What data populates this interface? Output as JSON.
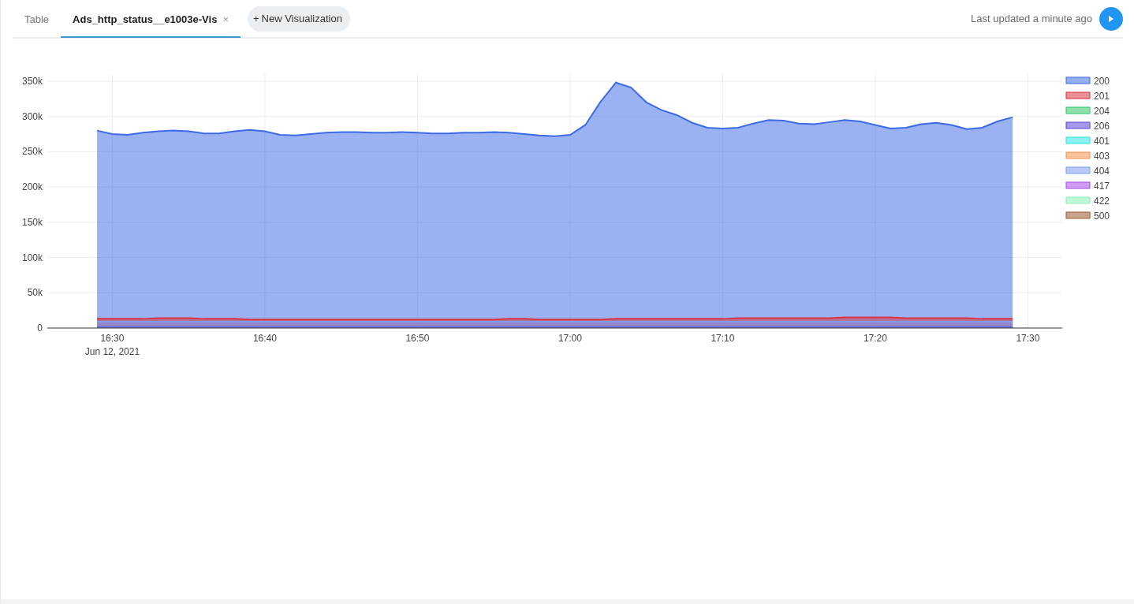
{
  "tabs": [
    {
      "label": "Table",
      "selected": false
    },
    {
      "label": "Ads_http_status__e1003e-Vis",
      "selected": true,
      "close": "×"
    }
  ],
  "new_button": {
    "icon": "+",
    "label": "New Visualization"
  },
  "status": {
    "text": "Last updated a minute ago"
  },
  "chart": {
    "chart_data": {
      "type": "area",
      "stacked": false,
      "categories": [
        null,
        "16:30",
        null,
        null,
        null,
        null,
        null,
        null,
        null,
        null,
        null,
        "16:40",
        null,
        null,
        null,
        null,
        null,
        null,
        null,
        null,
        null,
        "16:50",
        null,
        null,
        null,
        null,
        null,
        null,
        null,
        null,
        null,
        "17:00",
        null,
        null,
        null,
        null,
        null,
        null,
        null,
        null,
        null,
        "17:10",
        null,
        null,
        null,
        null,
        null,
        null,
        null,
        null,
        null,
        "17:20",
        null,
        null,
        null,
        null,
        null,
        null,
        null,
        null,
        null,
        "17:30"
      ],
      "ylim": [
        0,
        350000
      ],
      "grid": true,
      "legend": true,
      "yticks": [
        {
          "value": 0,
          "label": "0"
        },
        {
          "value": 50000,
          "label": "50k"
        },
        {
          "value": 100000,
          "label": "100k"
        },
        {
          "value": 150000,
          "label": "150k"
        },
        {
          "value": 200000,
          "label": "200k"
        },
        {
          "value": 250000,
          "label": "250k"
        },
        {
          "value": 300000,
          "label": "300k"
        },
        {
          "value": 350000,
          "label": "350k"
        }
      ],
      "series": [
        {
          "name": "200",
          "color": "#3d6be6",
          "values": [
            280000,
            275000,
            274000,
            277000,
            279000,
            280000,
            279000,
            276000,
            276000,
            279000,
            281000,
            279000,
            274000,
            273000,
            275000,
            277000,
            278000,
            278000,
            277000,
            277000,
            278000,
            277000,
            276000,
            276000,
            277000,
            277000,
            278000,
            277000,
            275000,
            273000,
            272000,
            274000,
            288000,
            321000,
            348000,
            341000,
            320000,
            309000,
            302000,
            291000,
            284000,
            283000,
            284000,
            290000,
            295000,
            294000,
            290000,
            289000,
            292000,
            295000,
            293000,
            288000,
            283000,
            284000,
            289000,
            291000,
            288000,
            282000,
            284000,
            293000,
            299000,
            null
          ]
        },
        {
          "name": "201",
          "color": "#d9333f",
          "values": [
            13000,
            13000,
            13000,
            13000,
            14000,
            14000,
            14000,
            13000,
            13000,
            13000,
            12000,
            12000,
            12000,
            12000,
            12000,
            12000,
            12000,
            12000,
            12000,
            12000,
            12000,
            12000,
            12000,
            12000,
            12000,
            12000,
            12000,
            13000,
            13000,
            12000,
            12000,
            12000,
            12000,
            12000,
            13000,
            13000,
            13000,
            13000,
            13000,
            13000,
            13000,
            13000,
            14000,
            14000,
            14000,
            14000,
            14000,
            14000,
            14000,
            15000,
            15000,
            15000,
            15000,
            14000,
            14000,
            14000,
            14000,
            14000,
            13000,
            13000,
            13000,
            null
          ]
        },
        {
          "name": "204",
          "color": "#2fc768",
          "values": [
            null,
            null,
            null,
            null,
            null,
            null,
            null,
            null,
            null,
            null,
            null,
            null,
            null,
            null,
            null,
            null,
            null,
            null,
            null,
            null,
            null,
            null,
            null,
            null,
            null,
            null,
            null,
            null,
            null,
            null,
            null,
            null,
            null,
            null,
            null,
            null,
            null,
            null,
            null,
            null,
            null,
            null,
            null,
            null,
            null,
            null,
            null,
            null,
            null,
            null,
            null,
            null,
            null,
            null,
            null,
            null,
            null,
            null,
            null,
            null,
            null,
            null
          ]
        },
        {
          "name": "206",
          "color": "#5a45d6",
          "values": [
            2000,
            2000,
            2000,
            2000,
            2000,
            2000,
            2000,
            2000,
            2000,
            2000,
            2000,
            2000,
            2000,
            2000,
            2000,
            2000,
            2000,
            2000,
            2000,
            2000,
            2000,
            2000,
            2000,
            2000,
            2000,
            2000,
            2000,
            2000,
            2000,
            2000,
            2000,
            2000,
            2000,
            2000,
            2000,
            2000,
            2000,
            2000,
            2000,
            2000,
            2000,
            2000,
            2000,
            2000,
            2000,
            2000,
            2000,
            2000,
            2000,
            2000,
            2000,
            2000,
            2000,
            2000,
            2000,
            2000,
            2000,
            2000,
            2000,
            2000,
            2000,
            null
          ]
        },
        {
          "name": "401",
          "color": "#2de3e0",
          "values": [
            null,
            null,
            null,
            null,
            null,
            null,
            null,
            null,
            null,
            null,
            null,
            null,
            null,
            null,
            null,
            null,
            null,
            null,
            null,
            null,
            null,
            null,
            null,
            null,
            null,
            null,
            null,
            null,
            null,
            null,
            null,
            null,
            null,
            null,
            null,
            null,
            null,
            null,
            null,
            null,
            null,
            null,
            null,
            null,
            null,
            null,
            null,
            null,
            null,
            null,
            null,
            null,
            null,
            null,
            null,
            null,
            null,
            null,
            null,
            null,
            null,
            null
          ]
        },
        {
          "name": "403",
          "color": "#f4914a",
          "values": [
            null,
            null,
            null,
            null,
            null,
            null,
            null,
            null,
            null,
            null,
            null,
            null,
            null,
            null,
            null,
            null,
            null,
            null,
            null,
            null,
            null,
            null,
            null,
            null,
            null,
            null,
            null,
            null,
            null,
            null,
            null,
            null,
            null,
            null,
            null,
            null,
            null,
            null,
            null,
            null,
            null,
            null,
            null,
            null,
            null,
            null,
            null,
            null,
            null,
            null,
            null,
            null,
            null,
            null,
            null,
            null,
            null,
            null,
            null,
            null,
            null,
            null
          ]
        },
        {
          "name": "404",
          "color": "#7d9cf0",
          "values": [
            9000,
            9000,
            9000,
            9000,
            9000,
            9000,
            9000,
            9000,
            9000,
            9000,
            9000,
            9000,
            9000,
            9000,
            9000,
            9000,
            9000,
            9000,
            9000,
            9000,
            9000,
            9000,
            9000,
            9000,
            9000,
            9000,
            9000,
            9000,
            9000,
            9000,
            9000,
            9000,
            9000,
            9000,
            9000,
            9000,
            9000,
            9000,
            9000,
            9000,
            9000,
            9000,
            9000,
            9000,
            9000,
            9000,
            9000,
            9000,
            9000,
            9000,
            9000,
            9000,
            9000,
            9000,
            9000,
            9000,
            9000,
            9000,
            9000,
            9000,
            9000,
            null
          ]
        },
        {
          "name": "417",
          "color": "#a54de8",
          "values": [
            null,
            null,
            null,
            null,
            null,
            null,
            null,
            null,
            null,
            null,
            null,
            null,
            null,
            null,
            null,
            null,
            null,
            null,
            null,
            null,
            null,
            null,
            null,
            null,
            null,
            null,
            null,
            null,
            null,
            null,
            null,
            null,
            null,
            null,
            null,
            null,
            null,
            null,
            null,
            null,
            null,
            null,
            null,
            null,
            null,
            null,
            null,
            null,
            null,
            null,
            null,
            null,
            null,
            null,
            null,
            null,
            null,
            null,
            null,
            null,
            null,
            null
          ]
        },
        {
          "name": "422",
          "color": "#8ef0b8",
          "values": [
            null,
            null,
            null,
            null,
            null,
            null,
            null,
            null,
            null,
            null,
            null,
            null,
            null,
            null,
            null,
            null,
            null,
            null,
            null,
            null,
            null,
            null,
            null,
            null,
            null,
            null,
            null,
            null,
            null,
            null,
            null,
            null,
            null,
            null,
            null,
            null,
            null,
            null,
            null,
            null,
            null,
            null,
            null,
            null,
            null,
            null,
            null,
            null,
            null,
            null,
            null,
            null,
            null,
            null,
            null,
            null,
            null,
            null,
            null,
            null,
            null,
            null
          ]
        },
        {
          "name": "500",
          "color": "#9a5a32",
          "values": [
            null,
            null,
            null,
            null,
            null,
            null,
            null,
            null,
            null,
            null,
            null,
            null,
            null,
            null,
            null,
            null,
            null,
            null,
            null,
            null,
            null,
            null,
            null,
            null,
            null,
            null,
            null,
            null,
            null,
            null,
            null,
            null,
            null,
            null,
            null,
            null,
            null,
            null,
            null,
            null,
            null,
            null,
            null,
            null,
            null,
            null,
            null,
            null,
            null,
            null,
            null,
            null,
            null,
            null,
            null,
            null,
            null,
            null,
            null,
            null,
            null,
            null
          ]
        }
      ]
    },
    "date_label": "Jun 12, 2021"
  }
}
